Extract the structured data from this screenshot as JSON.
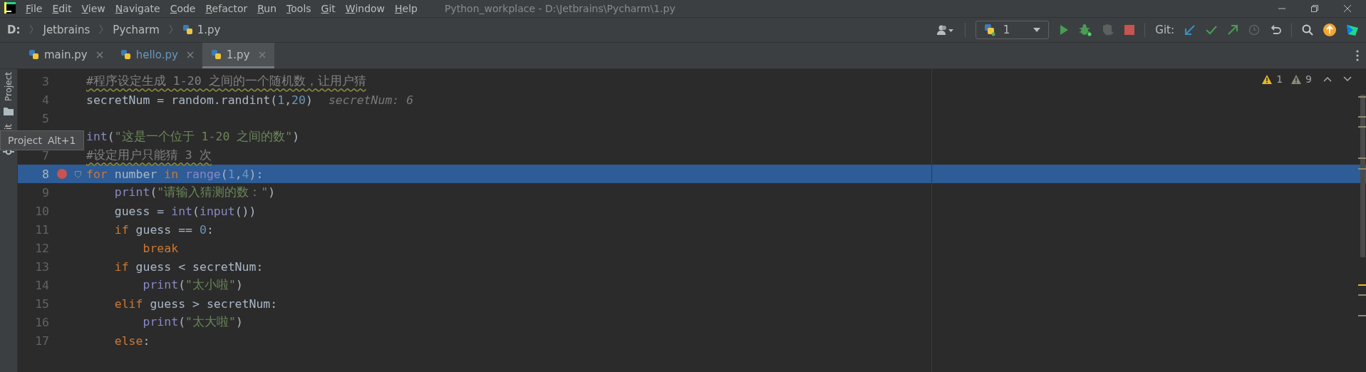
{
  "menu_bar": {
    "items": [
      "File",
      "Edit",
      "View",
      "Navigate",
      "Code",
      "Refactor",
      "Run",
      "Tools",
      "Git",
      "Window",
      "Help"
    ],
    "window_title": "Python_workplace - D:\\Jetbrains\\Pycharm\\1.py"
  },
  "breadcrumbs": [
    {
      "label": "D:",
      "kind": "drive"
    },
    {
      "label": "Jetbrains",
      "kind": "folder"
    },
    {
      "label": "Pycharm",
      "kind": "folder"
    },
    {
      "label": "1.py",
      "kind": "file"
    }
  ],
  "toolbar": {
    "run_config": "1",
    "git_label": "Git:"
  },
  "tabs": [
    {
      "label": "main.py",
      "selected": false,
      "changed": false
    },
    {
      "label": "hello.py",
      "selected": false,
      "changed": true
    },
    {
      "label": "1.py",
      "selected": true,
      "changed": false
    }
  ],
  "side_tabs": [
    {
      "label": "Project"
    },
    {
      "label": "it"
    }
  ],
  "tooltip": {
    "label": "Project",
    "shortcut": "Alt+1"
  },
  "inspections": {
    "warnings": "1",
    "weak_warnings": "9"
  },
  "lines": [
    {
      "number": "3",
      "breakpoint": false,
      "selected": false,
      "segments": [
        {
          "kind": "comment",
          "text": "#程序设定生成 1-20 之间的一个随机数，让用户猜"
        }
      ]
    },
    {
      "number": "4",
      "breakpoint": false,
      "selected": false,
      "segments": [
        {
          "kind": "plain",
          "text": "secretNum = random.randint("
        },
        {
          "kind": "number",
          "text": "1"
        },
        {
          "kind": "plain",
          "text": ","
        },
        {
          "kind": "number",
          "text": "20"
        },
        {
          "kind": "plain",
          "text": ")"
        }
      ],
      "hint": "secretNum: 6"
    },
    {
      "number": "5",
      "breakpoint": false,
      "selected": false
    },
    {
      "selected": false,
      "segments": [
        {
          "kind": "builtin",
          "text": "int"
        },
        {
          "kind": "plain",
          "text": "("
        },
        {
          "kind": "string",
          "text": "\"这是一个位于 1-20 之间的数\""
        },
        {
          "kind": "plain",
          "text": ")"
        }
      ]
    },
    {
      "number": "7",
      "breakpoint": false,
      "selected": false,
      "segments": [
        {
          "kind": "comment",
          "text": "#设定用户只能猜 3 次"
        }
      ]
    },
    {
      "number": "8",
      "breakpoint": true,
      "selected": true,
      "segments": [
        {
          "kind": "keyword",
          "text": "for"
        },
        {
          "kind": "plain",
          "text": " number "
        },
        {
          "kind": "keyword",
          "text": "in"
        },
        {
          "kind": "builtin",
          "text": " range"
        },
        {
          "kind": "plain",
          "text": "("
        },
        {
          "kind": "number",
          "text": "1"
        },
        {
          "kind": "plain",
          "text": ","
        },
        {
          "kind": "number",
          "text": "4"
        },
        {
          "kind": "plain",
          "text": "):"
        }
      ]
    },
    {
      "number": "9",
      "breakpoint": false,
      "selected": false,
      "segments": [
        {
          "kind": "builtin",
          "text": "    print"
        },
        {
          "kind": "plain",
          "text": "("
        },
        {
          "kind": "string",
          "text": "\"请输入猜测的数：\""
        },
        {
          "kind": "plain",
          "text": ")"
        }
      ]
    },
    {
      "number": "10",
      "breakpoint": false,
      "selected": false,
      "segments": [
        {
          "kind": "plain",
          "text": "    guess = "
        },
        {
          "kind": "builtin",
          "text": "int"
        },
        {
          "kind": "plain",
          "text": "("
        },
        {
          "kind": "builtin",
          "text": "input"
        },
        {
          "kind": "plain",
          "text": "())"
        }
      ]
    },
    {
      "number": "11",
      "breakpoint": false,
      "selected": false,
      "segments": [
        {
          "kind": "keyword",
          "text": "    if"
        },
        {
          "kind": "plain",
          "text": " guess == "
        },
        {
          "kind": "number",
          "text": "0"
        },
        {
          "kind": "plain",
          "text": ":"
        }
      ]
    },
    {
      "number": "12",
      "breakpoint": false,
      "selected": false,
      "segments": [
        {
          "kind": "keyword",
          "text": "        break"
        }
      ]
    },
    {
      "number": "13",
      "breakpoint": false,
      "selected": false,
      "segments": [
        {
          "kind": "keyword",
          "text": "    if"
        },
        {
          "kind": "plain",
          "text": " guess < secretNum:"
        }
      ]
    },
    {
      "number": "14",
      "breakpoint": false,
      "selected": false,
      "segments": [
        {
          "kind": "builtin",
          "text": "        print"
        },
        {
          "kind": "plain",
          "text": "("
        },
        {
          "kind": "string",
          "text": "\"太小啦\""
        },
        {
          "kind": "plain",
          "text": ")"
        }
      ]
    },
    {
      "number": "15",
      "breakpoint": false,
      "selected": false,
      "segments": [
        {
          "kind": "keyword",
          "text": "    elif"
        },
        {
          "kind": "plain",
          "text": " guess > secretNum:"
        }
      ]
    },
    {
      "number": "16",
      "breakpoint": false,
      "selected": false,
      "segments": [
        {
          "kind": "builtin",
          "text": "        print"
        },
        {
          "kind": "plain",
          "text": "("
        },
        {
          "kind": "string",
          "text": "\"太大啦\""
        },
        {
          "kind": "plain",
          "text": ")"
        }
      ]
    },
    {
      "number": "17",
      "breakpoint": false,
      "selected": false,
      "segments": [
        {
          "kind": "keyword",
          "text": "    else"
        },
        {
          "kind": "plain",
          "text": ":"
        }
      ]
    }
  ]
}
